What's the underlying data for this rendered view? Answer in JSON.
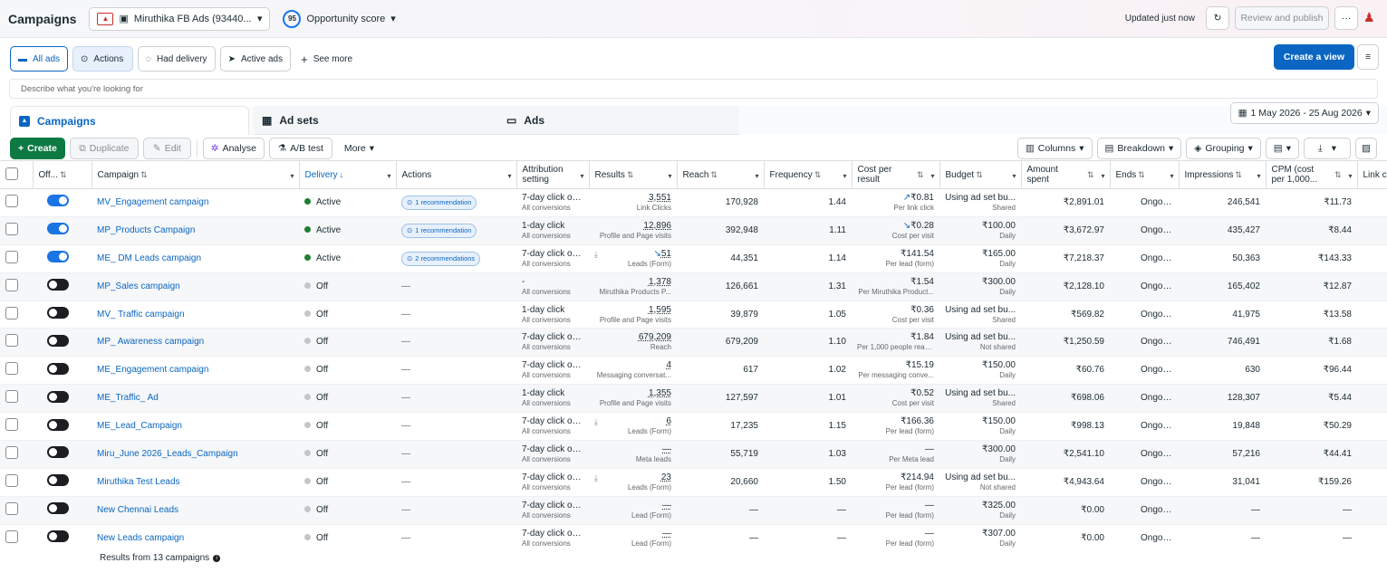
{
  "header": {
    "title": "Campaigns",
    "account_name": "Miruthika FB Ads (93440...",
    "opportunity_score": "95",
    "opportunity_label": "Opportunity score",
    "updated": "Updated just now",
    "review_label": "Review and publish"
  },
  "views": {
    "all_ads": "All ads",
    "actions": "Actions",
    "had_delivery": "Had delivery",
    "active_ads": "Active ads",
    "see_more": "See more",
    "create_view": "Create a view"
  },
  "search": {
    "placeholder": "Describe what you're looking for"
  },
  "tabs": {
    "campaigns": "Campaigns",
    "ad_sets": "Ad sets",
    "ads": "Ads"
  },
  "date_range": "1 May 2026 - 25 Aug 2026",
  "toolbar": {
    "create": "Create",
    "duplicate": "Duplicate",
    "edit": "Edit",
    "analyse": "Analyse",
    "ab_test": "A/B test",
    "more": "More",
    "columns": "Columns",
    "breakdown": "Breakdown",
    "grouping": "Grouping"
  },
  "columns": {
    "off": "Off...",
    "campaign": "Campaign",
    "delivery": "Delivery",
    "actions": "Actions",
    "attribution": "Attribution setting",
    "results": "Results",
    "reach": "Reach",
    "frequency": "Frequency",
    "cost": "Cost per result",
    "budget": "Budget",
    "amount": "Amount spent",
    "ends": "Ends",
    "impressions": "Impressions",
    "cpm": "CPM (cost per 1,000...",
    "link": "Link c"
  },
  "rows": [
    {
      "on": true,
      "name": "MV_Engagement campaign",
      "delivery": "Active",
      "rec": "1 recommendation",
      "attr": "7-day click or ...",
      "attr2": "All conversions",
      "results": "3,551",
      "results2": "Link Clicks",
      "reach": "170,928",
      "freq": "1.44",
      "cost": "₹0.81",
      "cost2": "Per link click",
      "budget": "Using ad set bu...",
      "budget2": "Shared",
      "spent": "₹2,891.01",
      "ends": "Ongoing",
      "impr": "246,541",
      "cpm": "₹11.73"
    },
    {
      "on": true,
      "name": "MP_Products Campaign",
      "delivery": "Active",
      "rec": "1 recommendation",
      "attr": "1-day click",
      "attr2": "All conversions",
      "results": "12,896",
      "results2": "Profile and Page visits",
      "reach": "392,948",
      "freq": "1.11",
      "cost": "₹0.28",
      "cost2": "Cost per visit",
      "budget": "₹100.00",
      "budget2": "Daily",
      "spent": "₹3,672.97",
      "ends": "Ongoing",
      "impr": "435,427",
      "cpm": "₹8.44"
    },
    {
      "on": true,
      "name": "ME_ DM Leads campaign",
      "delivery": "Active",
      "rec": "2 recommendations",
      "attr": "7-day click or ...",
      "attr2": "All conversions",
      "results": "51",
      "results2": "Leads (Form)",
      "reach": "44,351",
      "freq": "1.14",
      "cost": "₹141.54",
      "cost2": "Per lead (form)",
      "budget": "₹165.00",
      "budget2": "Daily",
      "spent": "₹7,218.37",
      "ends": "Ongoing",
      "impr": "50,363",
      "cpm": "₹143.33"
    },
    {
      "on": false,
      "name": "MP_Sales campaign",
      "delivery": "Off",
      "rec": "—",
      "attr": "-",
      "attr2": "All conversions",
      "results": "1,378",
      "results2": "Miruthika Products P...",
      "reach": "126,661",
      "freq": "1.31",
      "cost": "₹1.54",
      "cost2": "Per Miruthika Product...",
      "budget": "₹300.00",
      "budget2": "Daily",
      "spent": "₹2,128.10",
      "ends": "Ongoing",
      "impr": "165,402",
      "cpm": "₹12.87"
    },
    {
      "on": false,
      "name": "MV_ Traffic campaign",
      "delivery": "Off",
      "rec": "—",
      "attr": "1-day click",
      "attr2": "All conversions",
      "results": "1,595",
      "results2": "Profile and Page visits",
      "reach": "39,879",
      "freq": "1.05",
      "cost": "₹0.36",
      "cost2": "Cost per visit",
      "budget": "Using ad set bu...",
      "budget2": "Shared",
      "spent": "₹569.82",
      "ends": "Ongoing",
      "impr": "41,975",
      "cpm": "₹13.58"
    },
    {
      "on": false,
      "name": "MP_ Awareness campaign",
      "delivery": "Off",
      "rec": "—",
      "attr": "7-day click or ...",
      "attr2": "All conversions",
      "results": "679,209",
      "results2": "Reach",
      "reach": "679,209",
      "freq": "1.10",
      "cost": "₹1.84",
      "cost2": "Per 1,000 people reac...",
      "budget": "Using ad set bu...",
      "budget2": "Not shared",
      "spent": "₹1,250.59",
      "ends": "Ongoing",
      "impr": "746,491",
      "cpm": "₹1.68"
    },
    {
      "on": false,
      "name": "ME_Engagement campaign",
      "delivery": "Off",
      "rec": "—",
      "attr": "7-day click or ...",
      "attr2": "All conversions",
      "results": "4",
      "results2": "Messaging conversat...",
      "reach": "617",
      "freq": "1.02",
      "cost": "₹15.19",
      "cost2": "Per messaging conve...",
      "budget": "₹150.00",
      "budget2": "Daily",
      "spent": "₹60.76",
      "ends": "Ongoing",
      "impr": "630",
      "cpm": "₹96.44"
    },
    {
      "on": false,
      "name": "ME_Traffic_ Ad",
      "delivery": "Off",
      "rec": "—",
      "attr": "1-day click",
      "attr2": "All conversions",
      "results": "1,355",
      "results2": "Profile and Page visits",
      "reach": "127,597",
      "freq": "1.01",
      "cost": "₹0.52",
      "cost2": "Cost per visit",
      "budget": "Using ad set bu...",
      "budget2": "Shared",
      "spent": "₹698.06",
      "ends": "Ongoing",
      "impr": "128,307",
      "cpm": "₹5.44"
    },
    {
      "on": false,
      "name": "ME_Lead_Campaign",
      "delivery": "Off",
      "rec": "—",
      "attr": "7-day click or ...",
      "attr2": "All conversions",
      "results": "6",
      "results2": "Leads (Form)",
      "reach": "17,235",
      "freq": "1.15",
      "cost": "₹166.36",
      "cost2": "Per lead (form)",
      "budget": "₹150.00",
      "budget2": "Daily",
      "spent": "₹998.13",
      "ends": "Ongoing",
      "impr": "19,848",
      "cpm": "₹50.29"
    },
    {
      "on": false,
      "name": "Miru_June 2026_Leads_Campaign",
      "delivery": "Off",
      "rec": "—",
      "attr": "7-day click or ...",
      "attr2": "All conversions",
      "results": "—",
      "results2": "Meta leads",
      "reach": "55,719",
      "freq": "1.03",
      "cost": "—",
      "cost2": "Per Meta lead",
      "budget": "₹300.00",
      "budget2": "Daily",
      "spent": "₹2,541.10",
      "ends": "Ongoing",
      "impr": "57,216",
      "cpm": "₹44.41"
    },
    {
      "on": false,
      "name": "Miruthika Test Leads",
      "delivery": "Off",
      "rec": "—",
      "attr": "7-day click or ...",
      "attr2": "All conversions",
      "results": "23",
      "results2": "Leads (Form)",
      "reach": "20,660",
      "freq": "1.50",
      "cost": "₹214.94",
      "cost2": "Per lead (form)",
      "budget": "Using ad set bu...",
      "budget2": "Not shared",
      "spent": "₹4,943.64",
      "ends": "Ongoing",
      "impr": "31,041",
      "cpm": "₹159.26"
    },
    {
      "on": false,
      "name": "New Chennai Leads",
      "delivery": "Off",
      "rec": "—",
      "attr": "7-day click or ...",
      "attr2": "All conversions",
      "results": "—",
      "results2": "Lead (Form)",
      "reach": "—",
      "freq": "—",
      "cost": "—",
      "cost2": "Per lead (form)",
      "budget": "₹325.00",
      "budget2": "Daily",
      "spent": "₹0.00",
      "ends": "Ongoing",
      "impr": "—",
      "cpm": "—"
    },
    {
      "on": false,
      "name": "New Leads campaign",
      "delivery": "Off",
      "rec": "—",
      "attr": "7-day click or ...",
      "attr2": "All conversions",
      "results": "—",
      "results2": "Lead (Form)",
      "reach": "—",
      "freq": "—",
      "cost": "—",
      "cost2": "Per lead (form)",
      "budget": "₹307.00",
      "budget2": "Daily",
      "spent": "₹0.00",
      "ends": "Ongoing",
      "impr": "—",
      "cpm": "—"
    }
  ],
  "footer": "Results from 13 campaigns"
}
